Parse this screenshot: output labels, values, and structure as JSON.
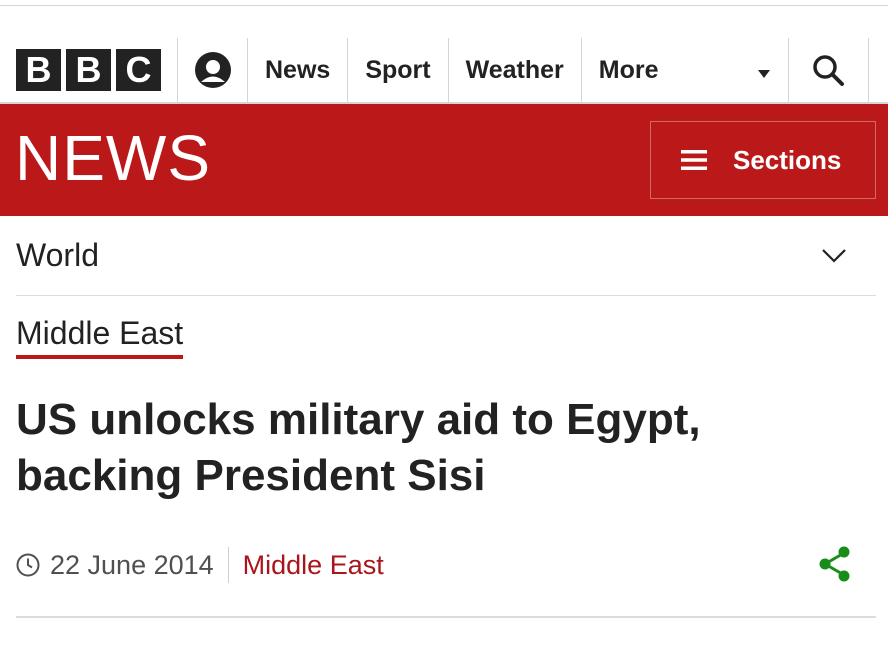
{
  "header": {
    "logo_letters": [
      "B",
      "B",
      "C"
    ],
    "nav_items": [
      "News",
      "Sport",
      "Weather"
    ],
    "more_label": "More"
  },
  "news_bar": {
    "wordmark": "NEWS",
    "sections_label": "Sections"
  },
  "region": {
    "label": "World"
  },
  "article": {
    "section_tag": "Middle East",
    "headline": "US unlocks military aid to Egypt, backing President Sisi",
    "date": "22 June 2014",
    "section_link": "Middle East"
  },
  "colors": {
    "brand_red": "#bb1919",
    "share_green": "#1a8c1a",
    "text": "#222222"
  },
  "icons": [
    "account-icon",
    "dropdown-triangle-icon",
    "search-icon",
    "hamburger-icon",
    "chevron-down-icon",
    "clock-icon",
    "share-icon"
  ]
}
